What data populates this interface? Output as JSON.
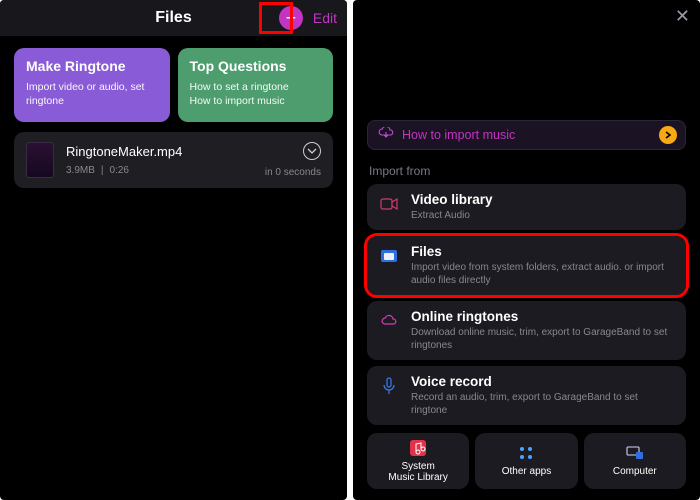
{
  "left": {
    "nav_title": "Files",
    "add_glyph": "+",
    "edit_label": "Edit",
    "cards": {
      "ringtone": {
        "title": "Make Ringtone",
        "body": "Import video or audio, set ringtone"
      },
      "faq": {
        "title": "Top Questions",
        "body": "How to set a ringtone\nHow to import music"
      }
    },
    "file": {
      "name": "RingtoneMaker.mp4",
      "size": "3.9MB",
      "dur_sep": " | ",
      "duration": "0:26",
      "age": "in 0 seconds"
    }
  },
  "right": {
    "close_glyph": "✕",
    "banner_text": "How to import music",
    "section_label": "Import from",
    "options": [
      {
        "id": "video-library",
        "title": "Video library",
        "desc": "Extract Audio"
      },
      {
        "id": "files",
        "title": "Files",
        "desc": "Import video from system folders, extract audio. or import audio files directly"
      },
      {
        "id": "online-ringtones",
        "title": "Online ringtones",
        "desc": "Download online music, trim, export to GarageBand to set ringtones"
      },
      {
        "id": "voice-record",
        "title": "Voice record",
        "desc": "Record an audio, trim, export to GarageBand to set ringtone"
      }
    ],
    "tiles": [
      {
        "id": "system-music",
        "label": "System\nMusic Library"
      },
      {
        "id": "other-apps",
        "label": "Other apps"
      },
      {
        "id": "computer",
        "label": "Computer"
      }
    ]
  }
}
